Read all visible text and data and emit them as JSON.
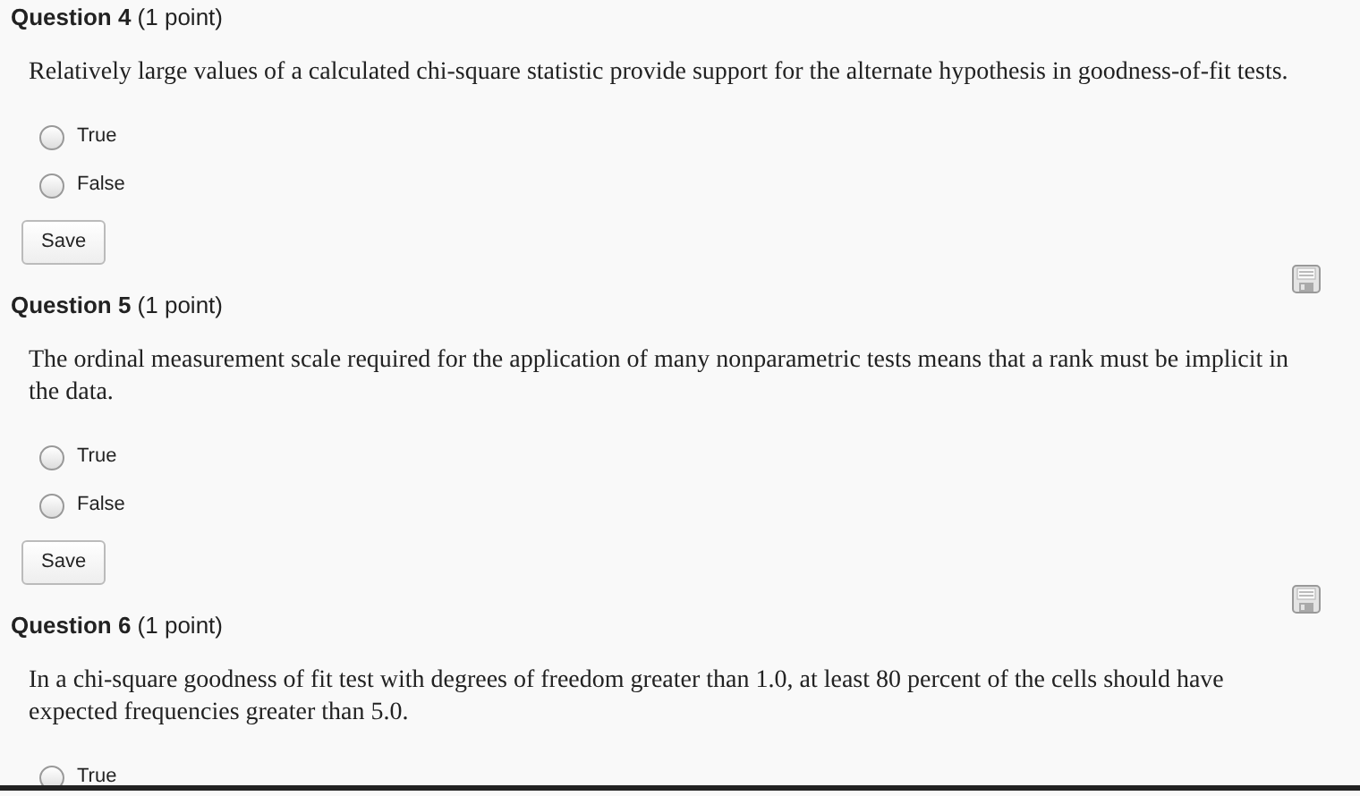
{
  "questions": [
    {
      "heading": "**Question 4** (1 point)",
      "save_icon": false,
      "text": "Relatively large values of a calculated chi-square statistic provide support for the alternate hypothesis in goodness-of-fit tests.",
      "options": [
        {
          "label": "True",
          "selected": false
        },
        {
          "label": "False",
          "selected": false
        }
      ],
      "button": "Save"
    },
    {
      "heading": "**Question 5** (1 point)",
      "save_icon": true,
      "text": "The ordinal measurement scale required for the application of many nonparametric tests means that a rank must be implicit in the data.",
      "options": [
        {
          "label": "True",
          "selected": false
        },
        {
          "label": "False",
          "selected": false
        }
      ],
      "button": "Save"
    },
    {
      "heading": "**Question 6** (1 point)",
      "save_icon": true,
      "text": "In a chi-square goodness of fit test with degrees of freedom greater than 1.0, at least 80 percent of the cells should have expected frequencies greater than 5.0.",
      "options": [
        {
          "label": "True",
          "selected": false
        }
      ]
    }
  ]
}
